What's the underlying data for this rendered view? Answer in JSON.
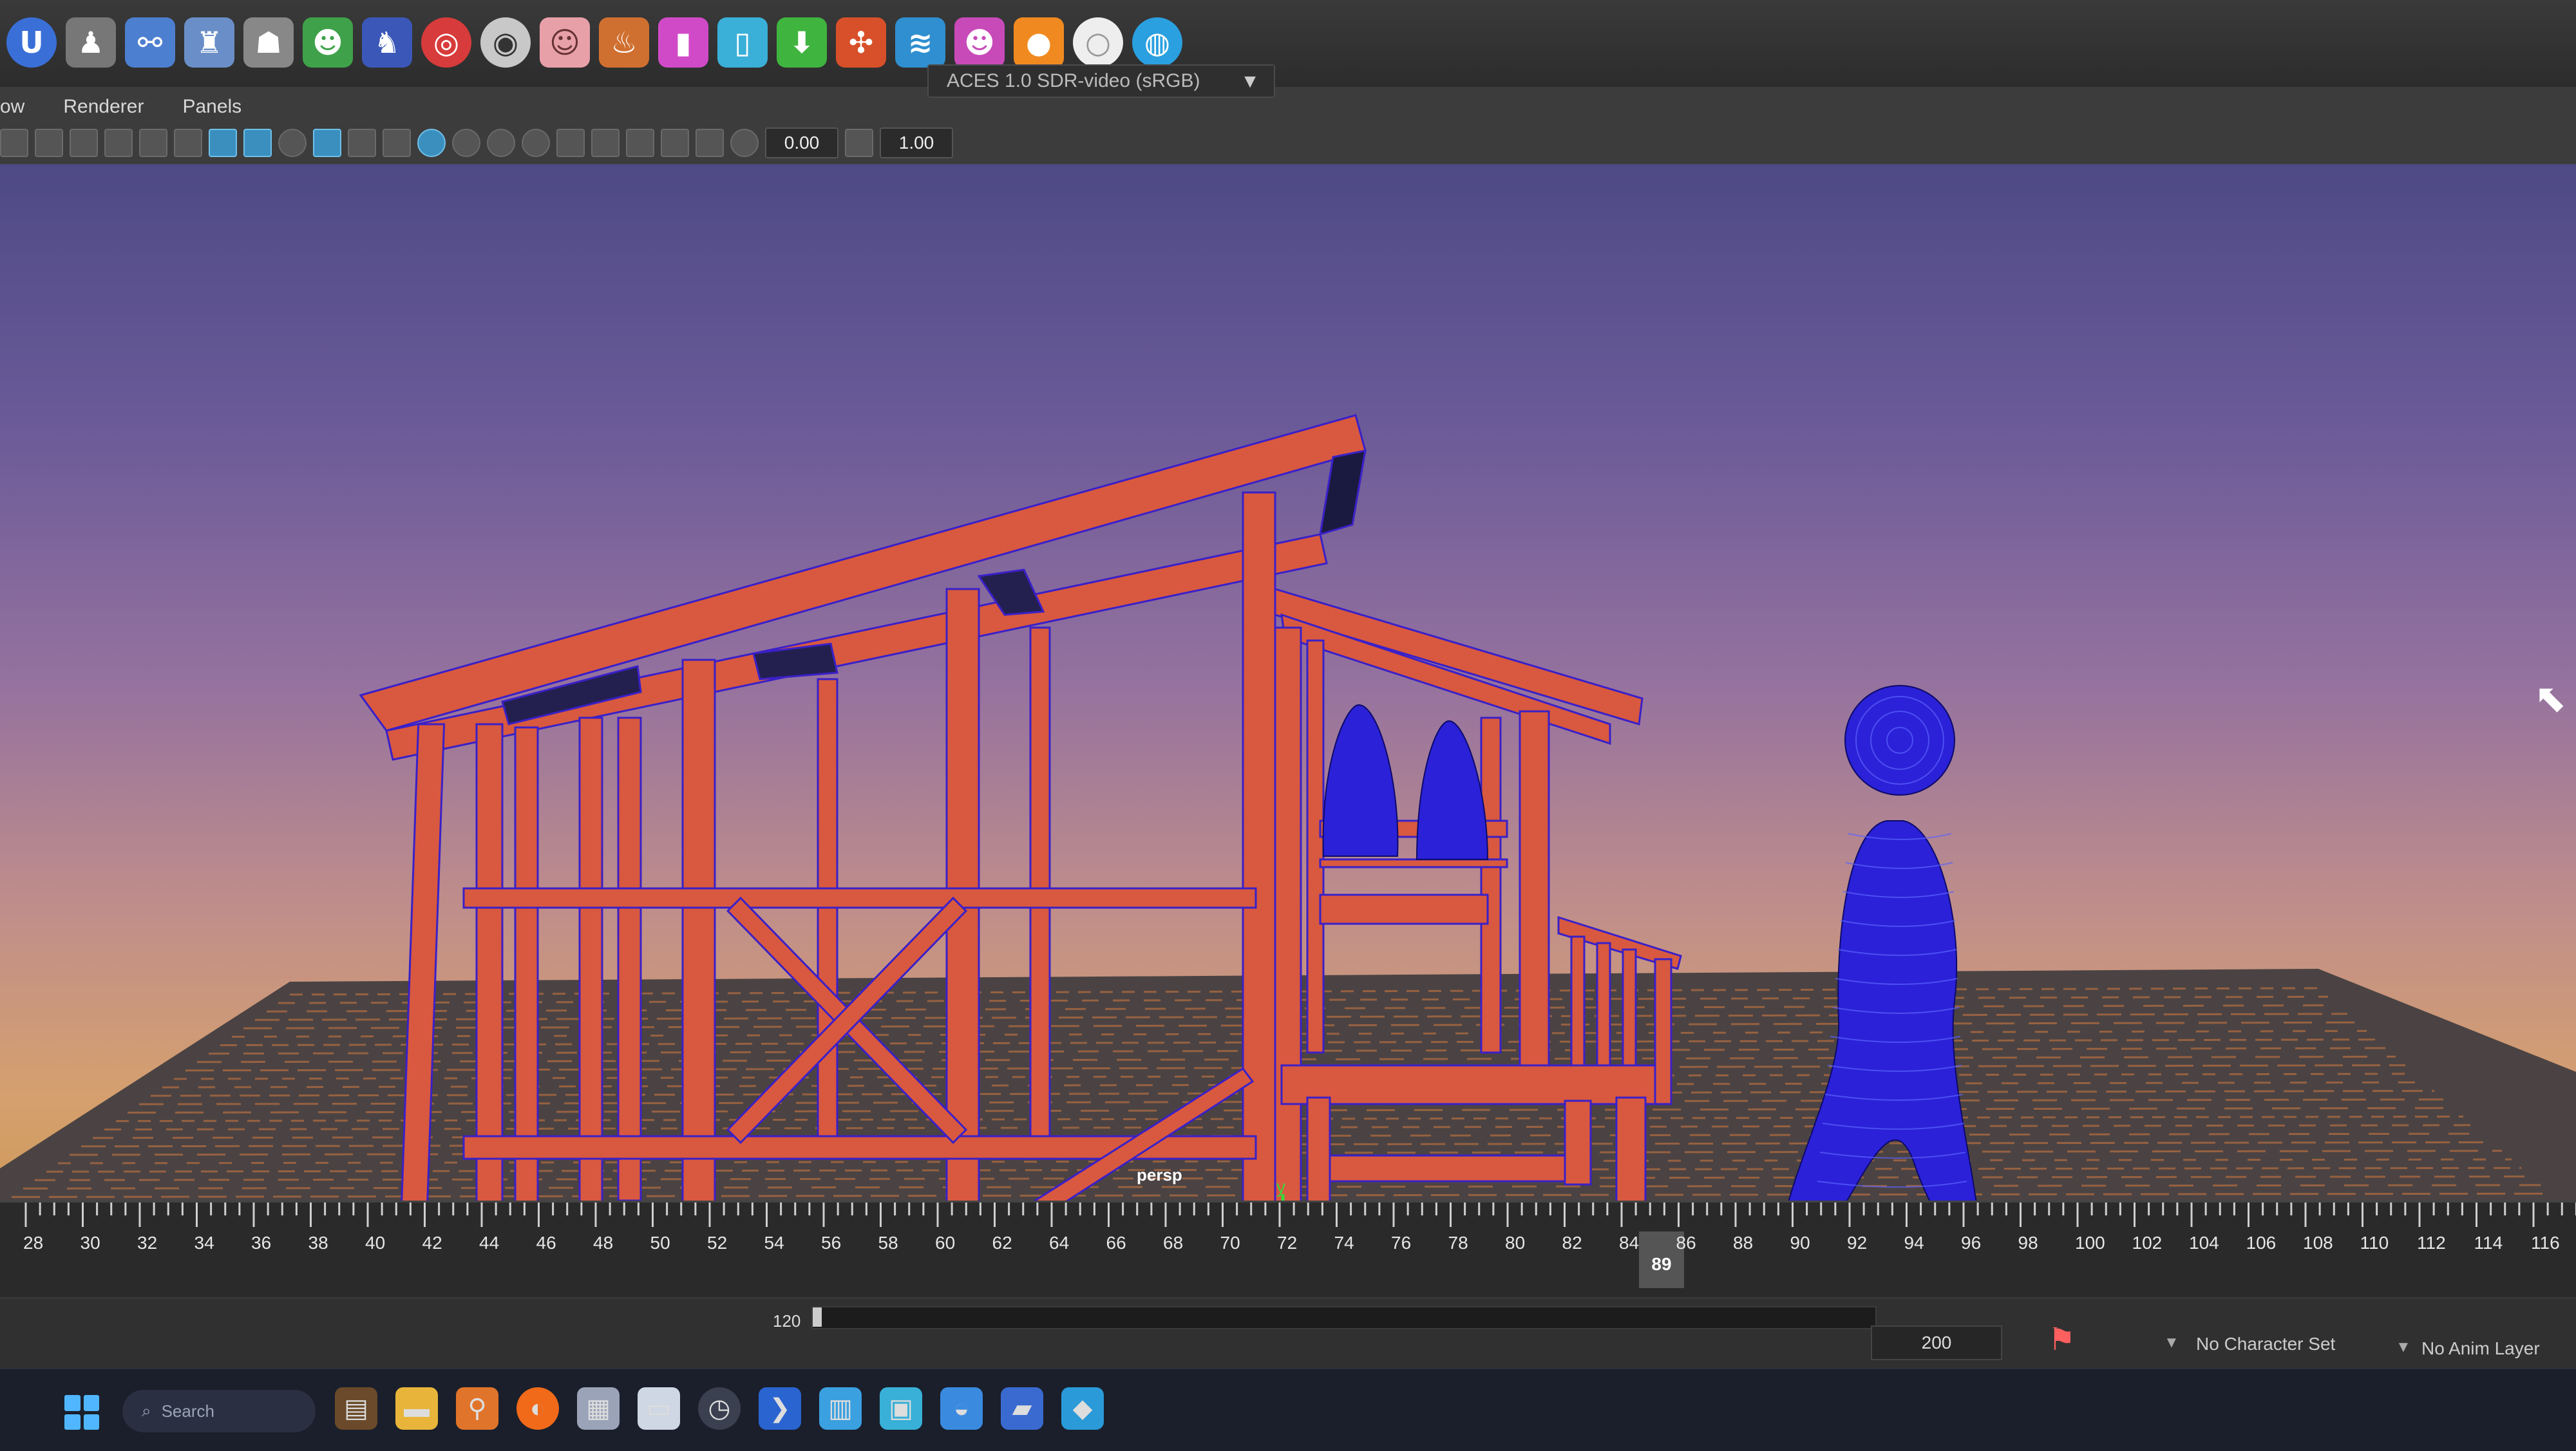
{
  "panel_menu": {
    "items": [
      "ow",
      "Renderer",
      "Panels"
    ]
  },
  "panel_toolbar": {
    "exposure_value": "0.00",
    "gamma_value": "1.00",
    "color_space": "ACES 1.0 SDR-video (sRGB)"
  },
  "viewport": {
    "camera_label": "persp",
    "axis_labels": {
      "y": "y",
      "x": "x"
    }
  },
  "time_slider": {
    "ticks": [
      "28",
      "30",
      "32",
      "34",
      "36",
      "38",
      "40",
      "42",
      "44",
      "46",
      "48",
      "50",
      "52",
      "54",
      "56",
      "58",
      "60",
      "62",
      "64",
      "66",
      "68",
      "70",
      "72",
      "74",
      "76",
      "78",
      "80",
      "82",
      "84",
      "86",
      "88",
      "90",
      "92",
      "94",
      "96",
      "98",
      "100",
      "102",
      "104",
      "106",
      "108",
      "110",
      "112",
      "114",
      "116"
    ],
    "current_frame": "89"
  },
  "range_slider": {
    "start_value": "120",
    "end_value": "200",
    "character_set": "No Character Set",
    "anim_layer": "No Anim Layer"
  },
  "taskbar": {
    "search_label": "Search"
  },
  "colors": {
    "frame_red": "#d8593f",
    "mesh_blue": "#2b21d8",
    "grid_line": "#e58a4a"
  }
}
